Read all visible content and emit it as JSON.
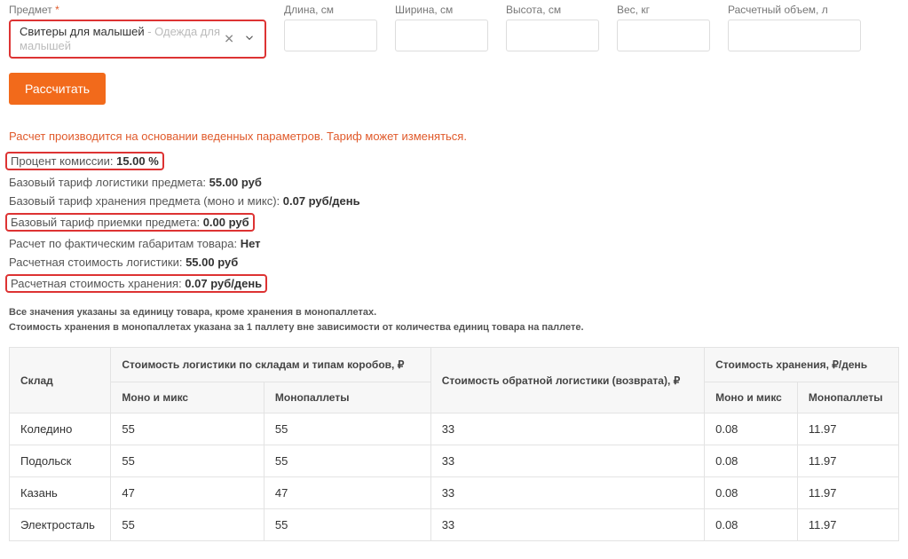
{
  "form": {
    "subject": {
      "label": "Предмет",
      "required": "*",
      "value_main": "Свитеры для малышей",
      "value_sub": " - Одежда для малышей"
    },
    "length": {
      "label": "Длина, см",
      "value": ""
    },
    "width": {
      "label": "Ширина, см",
      "value": ""
    },
    "height": {
      "label": "Высота, см",
      "value": ""
    },
    "weight": {
      "label": "Вес, кг",
      "value": ""
    },
    "volume": {
      "label": "Расчетный объем, л",
      "value": ""
    },
    "calc_btn": "Рассчитать"
  },
  "warning": "Расчет производится на основании веденных параметров. Тариф может изменяться.",
  "tariffs": {
    "commission": {
      "label": "Процент комиссии: ",
      "value": "15.00 %"
    },
    "logistics_base": {
      "label": "Базовый тариф логистики предмета: ",
      "value": "55.00 руб"
    },
    "storage_base": {
      "label": "Базовый тариф хранения предмета (моно и микс): ",
      "value": "0.07 руб/день"
    },
    "intake_base": {
      "label": "Базовый тариф приемки предмета: ",
      "value": "0.00 руб"
    },
    "by_actual_dims": {
      "label": "Расчет по фактическим габаритам товара: ",
      "value": "Нет"
    },
    "calc_logistics": {
      "label": "Расчетная стоимость логистики: ",
      "value": "55.00 руб"
    },
    "calc_storage": {
      "label": "Расчетная стоимость хранения: ",
      "value": "0.07 руб/день"
    }
  },
  "footnote1": "Все значения указаны за единицу товара, кроме хранения в монопаллетах.",
  "footnote2": "Стоимость хранения в монопаллетах указана за 1 паллету вне зависимости от количества единиц товара на паллете.",
  "table": {
    "headers": {
      "warehouse": "Склад",
      "logistics": "Стоимость логистики по складам и типам коробов, ₽",
      "return": "Стоимость обратной логистики (возврата), ₽",
      "storage": "Стоимость хранения, ₽/день",
      "mono_mix": "Моно и микс",
      "monopallets": "Монопаллеты"
    },
    "rows": [
      {
        "name": "Коледино",
        "log_mono": "55",
        "log_pal": "55",
        "ret": "33",
        "st_mono": "0.08",
        "st_pal": "11.97"
      },
      {
        "name": "Подольск",
        "log_mono": "55",
        "log_pal": "55",
        "ret": "33",
        "st_mono": "0.08",
        "st_pal": "11.97"
      },
      {
        "name": "Казань",
        "log_mono": "47",
        "log_pal": "47",
        "ret": "33",
        "st_mono": "0.08",
        "st_pal": "11.97"
      },
      {
        "name": "Электросталь",
        "log_mono": "55",
        "log_pal": "55",
        "ret": "33",
        "st_mono": "0.08",
        "st_pal": "11.97"
      }
    ]
  }
}
